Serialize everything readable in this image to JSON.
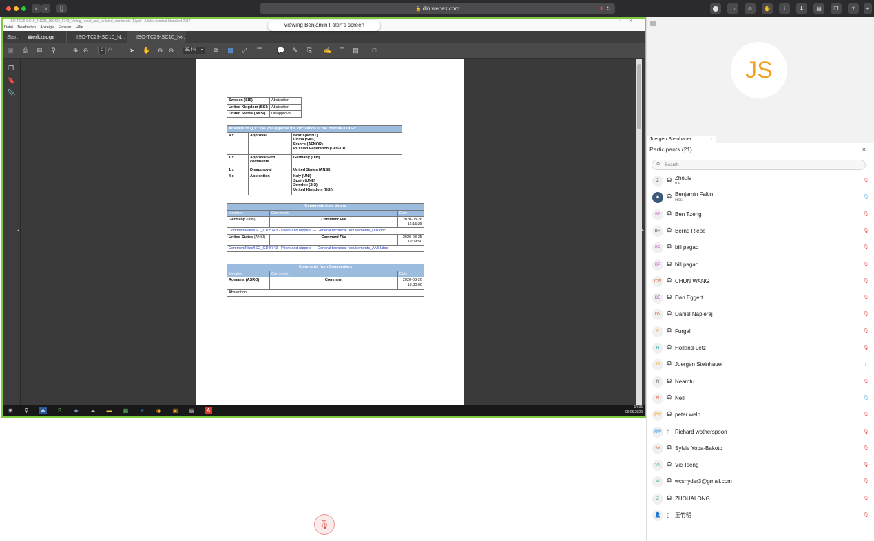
{
  "browser": {
    "url": "din.webex.com",
    "lock_icon": "lock-icon",
    "traffic_lights": [
      "#ff5f57",
      "#febc2e",
      "#28c840"
    ]
  },
  "shared_screen": {
    "viewing_label": "Viewing Benjamin Faltin's screen",
    "window_title": "ISO-TC29-SC10_N1221_ISOCD_5743_Voting_result_and_collated_comments (1).pdf - Adobe Acrobat Standard 2017",
    "menu": [
      "Datei",
      "Bearbeiten",
      "Anzeige",
      "Fenster",
      "Hilfe"
    ],
    "tabs": [
      {
        "label": "Start"
      },
      {
        "label": "Werkzeuge"
      },
      {
        "label": "ISO-TC29-SC10_N..."
      },
      {
        "label": "ISO-TC29-SC10_N..."
      }
    ],
    "tab_close": "×",
    "page_current": "2",
    "page_total": "/ 4",
    "zoom": "85,4%",
    "taskbar_time": "14:35",
    "taskbar_date": "09.06.2020"
  },
  "document": {
    "country_rows": [
      {
        "country": "Sweden (SIS)",
        "vote": "Abstention"
      },
      {
        "country": "United Kingdom (BSI)",
        "vote": "Abstention"
      },
      {
        "country": "United States (ANSI)",
        "vote": "Disapproval"
      }
    ],
    "answers_title": "Answers to Q.1: \"Do you approve the circulation of the draft as a DIS?\"",
    "answers": [
      {
        "count": "4 x",
        "type": "Approval",
        "members": [
          "Brazil (ABNT)",
          "China (SAC)",
          "France (AFNOR)",
          "Russian Federation (GOST R)"
        ]
      },
      {
        "count": "1 x",
        "type": "Approval with comments",
        "members": [
          "Germany (DIN)"
        ]
      },
      {
        "count": "1 x",
        "type": "Disapproval",
        "members": [
          "United States (ANSI)"
        ]
      },
      {
        "count": "4 x",
        "type": "Abstention",
        "members": [
          "Italy (UNI)",
          "Spain (UNE)",
          "Sweden (SIS)",
          "United Kingdom (BSI)"
        ]
      }
    ],
    "voters_title": "Comments from Voters",
    "col_member": "Member:",
    "col_comment": "Comment:",
    "col_date": "Date:",
    "voter_comments": [
      {
        "member": "Germany",
        "body": "(DIN)",
        "comment": "Comment File",
        "date": "2020-03-26",
        "time": "16:15:28",
        "link": "CommentFiles/ISO_CD 5743 - Pliers and nippers — General technical requirements_DIN.doc"
      },
      {
        "member": "United States",
        "body": "(ANSI)",
        "comment": "Comment File",
        "date": "2020-03-25",
        "time": "19:09:50",
        "link": "CommentFiles/ISO_CD 5743 - Pliers and nippers — General technical requirements_ANSI.doc"
      }
    ],
    "commenters_title": "Comments from Commenters",
    "commenter": {
      "member": "Romania (ASRO)",
      "comment": "Comment",
      "date": "2020-03-26",
      "time": "19:30:00",
      "note": "Abstention"
    }
  },
  "video": {
    "initials": "JS",
    "speaker": "Juergen Steinhauer",
    "initials_color": "#f0a024"
  },
  "participants": {
    "title": "Participants (21)",
    "close_icon": "×",
    "search_placeholder": "Search",
    "list": [
      {
        "initials": "Z",
        "name": "Zhoulv",
        "sub": "me",
        "color": "#555555",
        "device": "headset",
        "mic": "muted"
      },
      {
        "initials": "",
        "name": "Benjamin Faltin",
        "sub": "Host",
        "color": "#555555",
        "device": "headset",
        "mic": "on"
      },
      {
        "initials": "BT",
        "name": "Ben Tzeng",
        "sub": "",
        "color": "#c84bc8",
        "device": "headset",
        "mic": "muted"
      },
      {
        "initials": "BR",
        "name": "Bernd Riepe",
        "sub": "",
        "color": "#555555",
        "device": "headset",
        "mic": "muted"
      },
      {
        "initials": "BP",
        "name": "bill pagac",
        "sub": "",
        "color": "#c84bc8",
        "device": "headset",
        "mic": "muted"
      },
      {
        "initials": "BP",
        "name": "bill pagac",
        "sub": "",
        "color": "#c84bc8",
        "device": "headset",
        "mic": "muted"
      },
      {
        "initials": "CW",
        "name": "CHUN WANG",
        "sub": "",
        "color": "#e0553a",
        "device": "headset",
        "mic": "muted"
      },
      {
        "initials": "DE",
        "name": "Dan Eggert",
        "sub": "",
        "color": "#9b59b6",
        "device": "headset",
        "mic": "muted"
      },
      {
        "initials": "DN",
        "name": "Daniel Napieraj",
        "sub": "",
        "color": "#e0553a",
        "device": "headset",
        "mic": "muted"
      },
      {
        "initials": "F",
        "name": "Furgal",
        "sub": "",
        "color": "#f0a024",
        "device": "headset",
        "mic": "muted"
      },
      {
        "initials": "H",
        "name": "Holland-Letz",
        "sub": "",
        "color": "#27a9a0",
        "device": "headset",
        "mic": "muted"
      },
      {
        "initials": "JS",
        "name": "Juergen Steinhauer",
        "sub": "",
        "color": "#f0a024",
        "device": "headset",
        "mic": "active"
      },
      {
        "initials": "N",
        "name": "Neamtu",
        "sub": "",
        "color": "#555555",
        "device": "headset",
        "mic": "muted"
      },
      {
        "initials": "N",
        "name": "Neill",
        "sub": "",
        "color": "#e0553a",
        "device": "headset",
        "mic": "on"
      },
      {
        "initials": "PW",
        "name": "peter welp",
        "sub": "",
        "color": "#f0a024",
        "device": "headset",
        "mic": "muted"
      },
      {
        "initials": "RW",
        "name": "Richard wotherspoon",
        "sub": "",
        "color": "#2f8fd8",
        "device": "phone",
        "mic": "muted"
      },
      {
        "initials": "SY",
        "name": "Sylvie Yoba-Bakoto",
        "sub": "",
        "color": "#e0553a",
        "device": "headset",
        "mic": "muted"
      },
      {
        "initials": "VT",
        "name": "Vic Tseng",
        "sub": "",
        "color": "#27a9a0",
        "device": "headset",
        "mic": "muted"
      },
      {
        "initials": "W",
        "name": "wcsnyder3@gmail.com",
        "sub": "",
        "color": "#27a9a0",
        "device": "headset",
        "mic": "muted"
      },
      {
        "initials": "Z",
        "name": "ZHOUALONG",
        "sub": "",
        "color": "#27a9a0",
        "device": "headset",
        "mic": "muted"
      },
      {
        "initials": "",
        "name": "王竹明",
        "sub": "",
        "color": "#555555",
        "device": "phone",
        "mic": "muted"
      }
    ]
  },
  "controls": {
    "mute_icon": "microphone-muted-icon"
  },
  "colors": {
    "share_border": "#7ecb3f",
    "table_header": "#9bbbdf",
    "muted_red": "#d9534f",
    "mic_on_blue": "#5aa9e6",
    "active_green": "#5cb85c"
  }
}
